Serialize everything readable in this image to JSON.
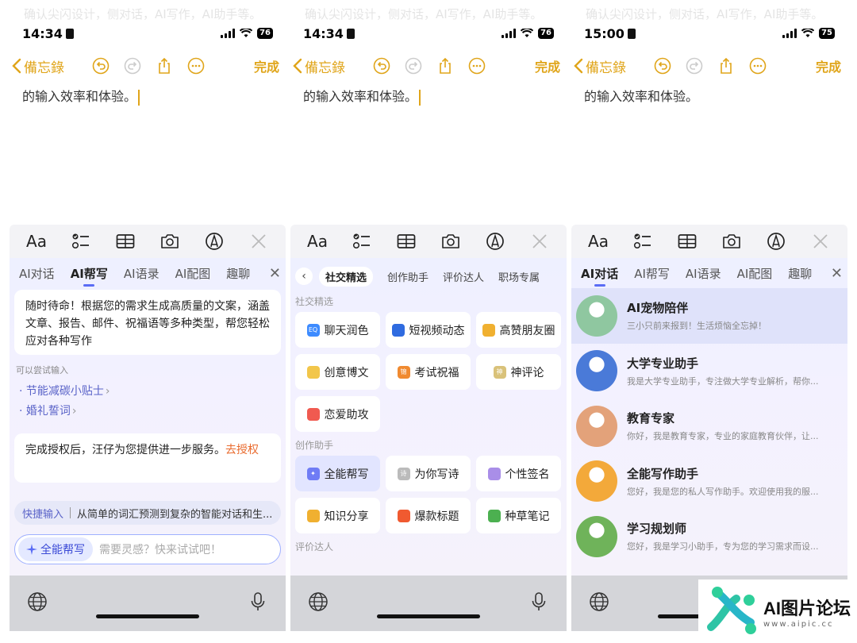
{
  "panels": [
    {
      "time": "14:34",
      "battery": "76",
      "faded_text": "确认尖闪设计，侧对话，AI写作，AI助手等。",
      "back_label": "備忘錄",
      "done_label": "完成",
      "note_text": "的输入效率和体验。",
      "toolbar": {
        "format_label": "Aa"
      },
      "tabs": [
        "AI对话",
        "AI帮写",
        "AI语录",
        "AI配图",
        "趣聊"
      ],
      "intro": "随时待命！根据您的需求生成高质量的文案，涵盖文章、报告、邮件、祝福语等多种类型，帮您轻松应对各种写作",
      "try_hint": "可以尝试输入",
      "try_items": [
        "· 节能减碳小贴士",
        "· 婚礼誓词"
      ],
      "auth_text": "完成授权后，汪仔为您提供进一步服务。",
      "auth_link": "去授权",
      "quick_label": "快捷输入",
      "quick_text": "从简单的词汇预测到复杂的智能对话和生...",
      "chip_label": "全能帮写",
      "input_placeholder": "需要灵感？快来试试吧！"
    },
    {
      "time": "14:34",
      "battery": "76",
      "faded_text": "确认尖闪设计，侧对话，AI写作，AI助手等。",
      "back_label": "備忘錄",
      "done_label": "完成",
      "note_text": "的输入效率和体验。",
      "toolbar": {
        "format_label": "Aa"
      },
      "subtabs": [
        "社交精选",
        "创作助手",
        "评价达人",
        "职场专属"
      ],
      "sections": [
        {
          "title": "社交精选",
          "items": [
            {
              "label": "聊天润色",
              "color": "#3d8bff",
              "glyph": "EQ"
            },
            {
              "label": "短视频动态",
              "color": "#2f6be0",
              "glyph": ""
            },
            {
              "label": "高赞朋友圈",
              "color": "#f0b030",
              "glyph": ""
            },
            {
              "label": "创意博文",
              "color": "#f2c64a",
              "glyph": ""
            },
            {
              "label": "考试祝福",
              "color": "#f08a30",
              "glyph": "锦"
            },
            {
              "label": "神评论",
              "color": "#d9c27a",
              "glyph": "神"
            },
            {
              "label": "恋爱助攻",
              "color": "#f05a50",
              "glyph": ""
            }
          ]
        },
        {
          "title": "创作助手",
          "items": [
            {
              "label": "全能帮写",
              "color": "#6f7cf5",
              "glyph": "✦"
            },
            {
              "label": "为你写诗",
              "color": "#bbbbbb",
              "glyph": "诗"
            },
            {
              "label": "个性签名",
              "color": "#a98ee8",
              "glyph": ""
            },
            {
              "label": "知识分享",
              "color": "#f0b030",
              "glyph": ""
            },
            {
              "label": "爆款标题",
              "color": "#f05a30",
              "glyph": ""
            },
            {
              "label": "种草笔记",
              "color": "#4cb050",
              "glyph": ""
            }
          ]
        },
        {
          "title": "评价达人",
          "items": []
        }
      ]
    },
    {
      "time": "15:00",
      "battery": "75",
      "faded_text": "确认尖闪设计，侧对话，AI写作，AI助手等。",
      "back_label": "備忘錄",
      "done_label": "完成",
      "note_text": "的输入效率和体验。",
      "toolbar": {
        "format_label": "Aa"
      },
      "tabs": [
        "AI对话",
        "AI帮写",
        "AI语录",
        "AI配图",
        "趣聊"
      ],
      "agents": [
        {
          "name": "AI宠物陪伴",
          "desc": "三小只前来报到！生活烦恼全忘掉！",
          "color": "#8fc7a0"
        },
        {
          "name": "大学专业助手",
          "desc": "我是大学专业助手，专注做大学专业解析，帮你...",
          "color": "#4a7ad8"
        },
        {
          "name": "教育专家",
          "desc": "你好，我是教育专家，专业的家庭教育伙伴，让...",
          "color": "#e3a27a"
        },
        {
          "name": "全能写作助手",
          "desc": "您好，我是您的私人写作助手。欢迎使用我的服...",
          "color": "#f3a93a"
        },
        {
          "name": "学习规划师",
          "desc": "您好，我是学习小助手，专为您的学习需求而设...",
          "color": "#6fb35a"
        }
      ]
    }
  ],
  "watermark": {
    "title": "AI图片论坛",
    "url": "www.aipic.cc"
  }
}
